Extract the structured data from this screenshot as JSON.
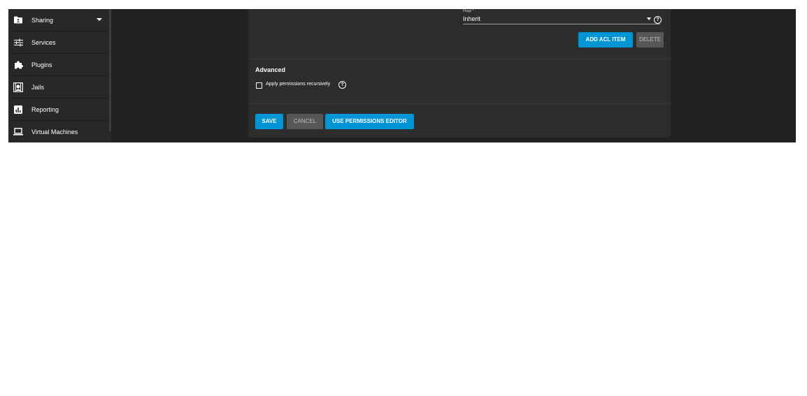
{
  "sidebar": {
    "items": [
      {
        "label": "Sharing",
        "icon": "folder-share-icon",
        "has_submenu": true
      },
      {
        "label": "Services",
        "icon": "tune-icon"
      },
      {
        "label": "Plugins",
        "icon": "puzzle-icon"
      },
      {
        "label": "Jails",
        "icon": "jail-icon"
      },
      {
        "label": "Reporting",
        "icon": "chart-icon"
      },
      {
        "label": "Virtual Machines",
        "icon": "laptop-icon"
      }
    ]
  },
  "acl": {
    "flags_label": "Flags *",
    "flags_value": "Inherit",
    "add_item_label": "ADD ACL ITEM",
    "delete_label": "DELETE"
  },
  "advanced": {
    "title": "Advanced",
    "recursive_label": "Apply permissions recursively",
    "recursive_checked": false
  },
  "actions": {
    "save_label": "SAVE",
    "cancel_label": "CANCEL",
    "editor_label": "USE PERMISSIONS EDITOR"
  },
  "colors": {
    "primary": "#0095d5",
    "muted_button": "#575757",
    "background": "#212121",
    "card": "#2d2d2d",
    "sidebar": "#282828"
  }
}
